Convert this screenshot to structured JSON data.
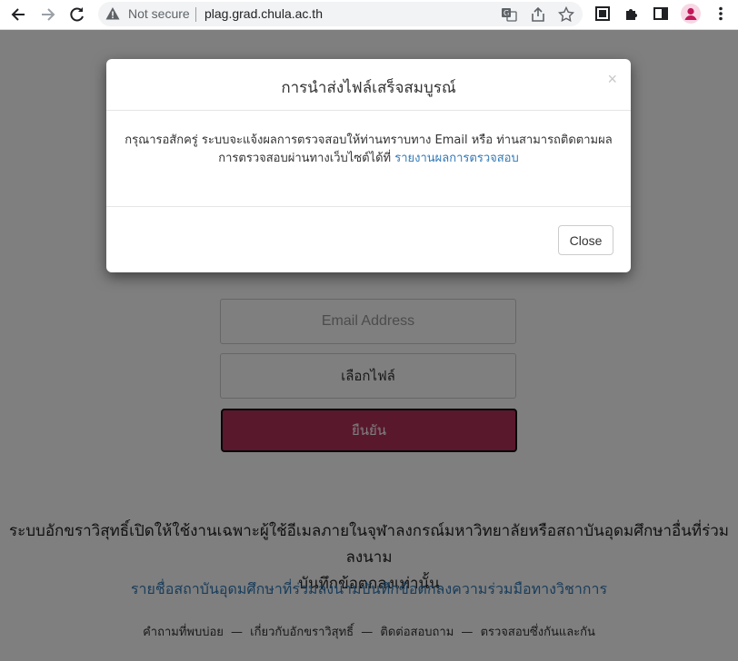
{
  "browser": {
    "security_label": "Not secure",
    "url": "plag.grad.chula.ac.th",
    "icons": [
      "back-icon",
      "forward-icon",
      "reload-icon",
      "warning-icon",
      "translate-icon",
      "share-icon",
      "star-icon",
      "tab-search-icon",
      "extensions-icon",
      "sidepanel-icon",
      "profile-icon",
      "menu-icon"
    ],
    "profile_color": "#c2185b"
  },
  "form": {
    "email_placeholder": "Email Address",
    "choose_file_label": "เลือกไฟล์",
    "submit_label": "ยืนยัน",
    "submit_color": "#b5305a"
  },
  "notice": {
    "line1": "ระบบอักขราวิสุทธิ์เปิดให้ใช้งานเฉพาะผู้ใช้อีเมลภายในจุฬาลงกรณ์มหาวิทยาลัยหรือสถาบันอุดมศึกษาอื่นที่ร่วมลงนาม",
    "line2": "บันทึกข้อตกลงเท่านั้น",
    "institutions_link": "รายชื่อสถาบันอุดมศึกษาที่ร่วมลงนามบันทึกข้อตกลงความร่วมมือทางวิชาการ"
  },
  "footer": {
    "links": [
      "คำถามที่พบบ่อย",
      "เกี่ยวกับอักขราวิสุทธิ์",
      "ติดต่อสอบถาม",
      "ตรวจสอบซึ่งกันและกัน"
    ],
    "separator": "—"
  },
  "modal": {
    "title": "การนำส่งไฟล์เสร็จสมบูรณ์",
    "close_x": "×",
    "body_line1": "กรุณารอสักครู่ ระบบจะแจ้งผลการตรวจสอบให้ท่านทราบทาง Email หรือ ท่านสามารถติดตามผล",
    "body_line2_prefix": "การตรวจสอบผ่านทางเว็บไซต์ได้ที่",
    "body_link": "รายงานผลการตรวจสอบ",
    "close_button": "Close",
    "link_color": "#337ab7"
  }
}
